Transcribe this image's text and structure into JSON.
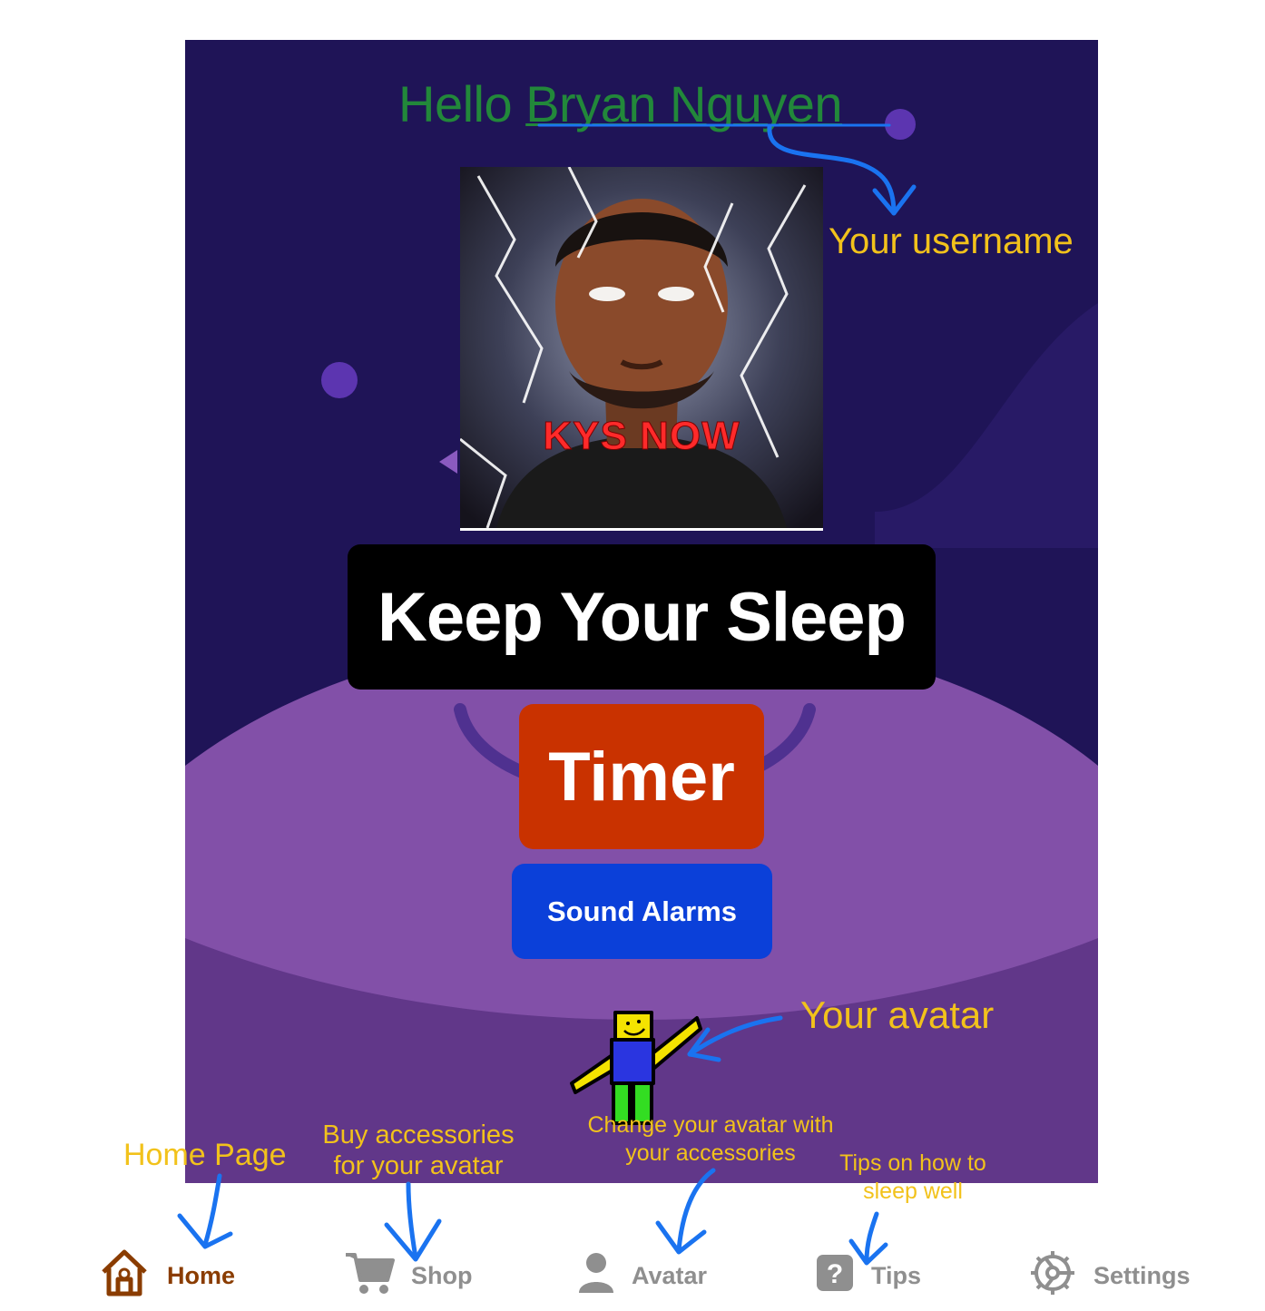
{
  "greeting": {
    "prefix": "Hello",
    "username": "Bryan Nguyen"
  },
  "profile_image": {
    "caption": "KYS NOW"
  },
  "buttons": {
    "keep_sleep": "Keep Your Sleep",
    "timer": "Timer",
    "sound_alarms": "Sound Alarms"
  },
  "annotations": {
    "username": "Your username",
    "avatar": "Your avatar",
    "home": "Home Page",
    "shop_line1": "Buy accessories",
    "shop_line2": "for your avatar",
    "avatar_tab_line1": "Change your avatar with",
    "avatar_tab_line2": "your accessories",
    "tips_line1": "Tips on how to",
    "tips_line2": "sleep well"
  },
  "tabs": [
    {
      "label": "Home",
      "icon": "home-icon",
      "active": true
    },
    {
      "label": "Shop",
      "icon": "cart-icon",
      "active": false
    },
    {
      "label": "Avatar",
      "icon": "person-icon",
      "active": false
    },
    {
      "label": "Tips",
      "icon": "help-icon",
      "active": false
    },
    {
      "label": "Settings",
      "icon": "gear-icon",
      "active": false
    }
  ],
  "colors": {
    "background": "#1f1457",
    "purple_wave": "#8250a8",
    "greeting": "#22883a",
    "annotation": "#f2c21b",
    "arrow": "#1a73f0",
    "keep_button": "#000000",
    "timer_button": "#c93200",
    "sound_button": "#0b40d9",
    "tab_active": "#8a3c00",
    "tab_inactive": "#8f8f8f"
  }
}
